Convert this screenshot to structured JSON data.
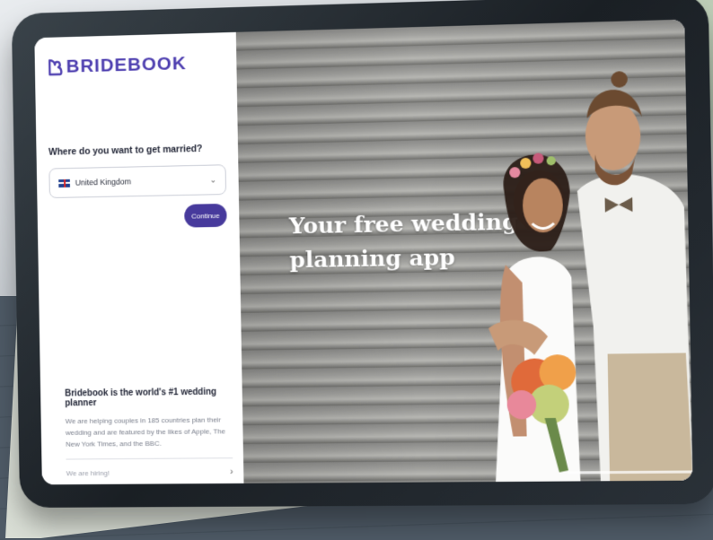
{
  "app": {
    "brand_name": "BRIDEBOOK",
    "brand_color": "#4e3fb0"
  },
  "onboarding": {
    "question": "Where do you want to get married?",
    "country_select": {
      "selected_value": "United Kingdom",
      "flag_icon": "uk-flag-icon"
    },
    "continue_label": "Continue"
  },
  "footer": {
    "title": "Bridebook is the world's #1 wedding planner",
    "body": "We are helping couples in 185 countries plan their wedding and are featured by the likes of Apple, The New York Times, and the BBC.",
    "hiring_label": "We are hiring!"
  },
  "hero": {
    "headline": "Your free wedding planning app"
  }
}
